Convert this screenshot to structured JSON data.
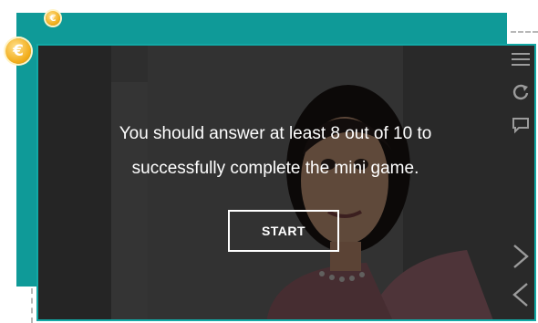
{
  "popup": {
    "line1": "You should answer at least 8 out of 10 to",
    "line2": "successfully complete the mini game.",
    "start_label": "START"
  },
  "badges": {
    "small_symbol": "€",
    "large_symbol": "€"
  },
  "icons": [
    "menu-icon",
    "replay-icon",
    "chat-icon",
    "next-icon",
    "previous-icon",
    "coin-icon"
  ],
  "colors": {
    "teal_panel": "#0f9a98",
    "teal_border": "#12a8a5",
    "overlay": "rgba(0,0,0,0.58)",
    "coin_gold": "#f2ad1b",
    "text_white": "#ffffff"
  }
}
